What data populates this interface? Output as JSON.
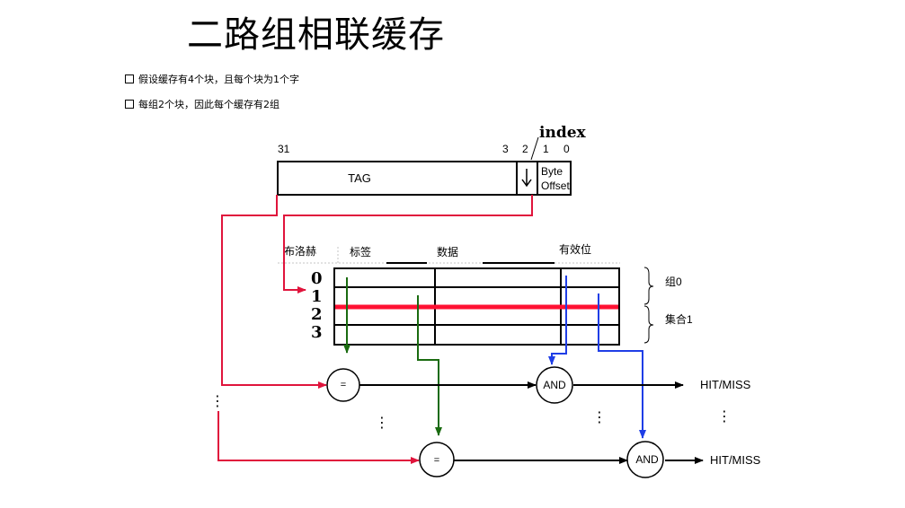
{
  "title": "二路组相联缓存",
  "bullets": [
    "假设缓存有4个块，且每个块为1个字",
    "每组2个块，因此每个缓存有2组"
  ],
  "address": {
    "bit_31": "31",
    "bit_3": "3",
    "bit_2": "2",
    "bit_1": "1",
    "bit_0": "0",
    "tag_label": "TAG",
    "index_label": "index",
    "offset_line1": "Byte",
    "offset_line2": "Offset"
  },
  "columns": {
    "boolean": "布洛赫",
    "tag": "标签",
    "data": "数据",
    "valid": "有效位"
  },
  "rows": [
    "0",
    "1",
    "2",
    "3"
  ],
  "groups": {
    "set0": "组0",
    "set1": "集合1"
  },
  "gates": {
    "equal": "=",
    "and": "AND"
  },
  "outputs": {
    "hit_miss_1": "HIT/MISS",
    "hit_miss_2": "HIT/MISS"
  },
  "ellipsis": "⋮",
  "colors": {
    "red": "#e0143c",
    "green": "#1a6b10",
    "blue": "#1f3ee6",
    "black": "#000000"
  }
}
